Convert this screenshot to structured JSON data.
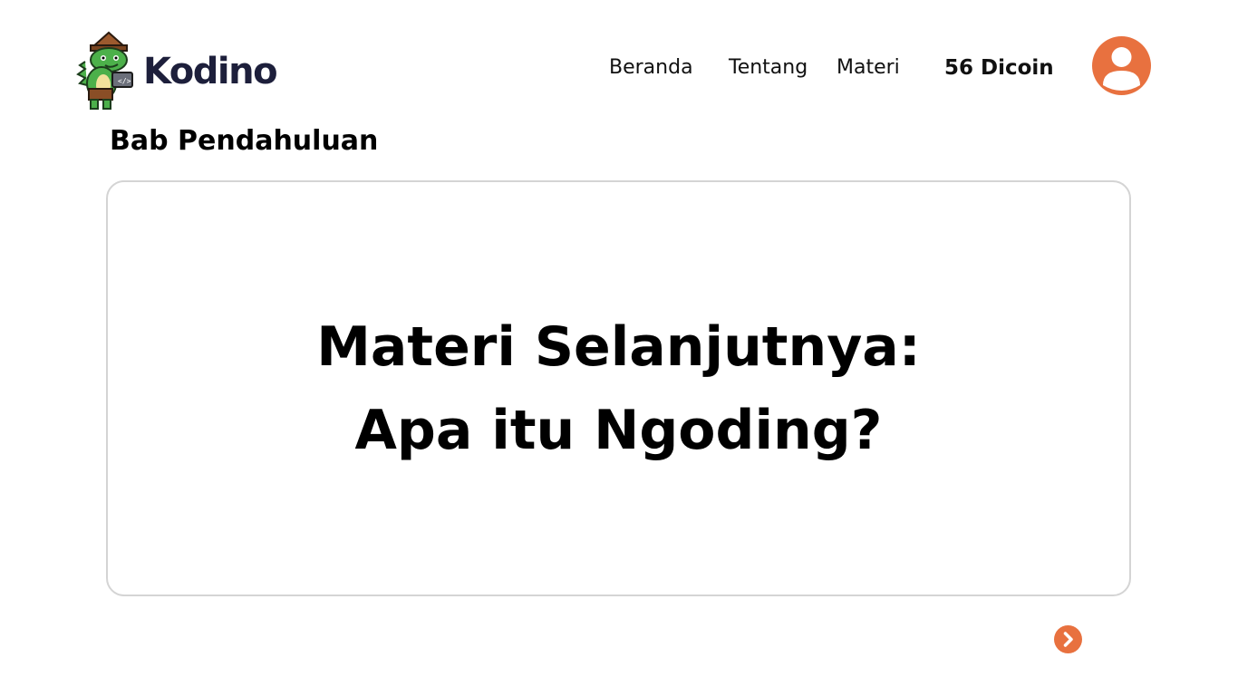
{
  "brand": {
    "name": "Kodino",
    "logo_icon": "dino-mascot-icon",
    "text_color": "#1d1f3b"
  },
  "nav": {
    "items": [
      {
        "label": "Beranda"
      },
      {
        "label": "Tentang"
      },
      {
        "label": "Materi"
      }
    ]
  },
  "user": {
    "coins": "56 Dicoin",
    "avatar_icon": "user-icon",
    "accent": "#e8713f"
  },
  "lesson": {
    "chapter_title": "Bab Pendahuluan",
    "card_line1": "Materi Selanjutnya:",
    "card_line2": "Apa itu Ngoding?",
    "next_icon": "chevron-right-icon"
  }
}
